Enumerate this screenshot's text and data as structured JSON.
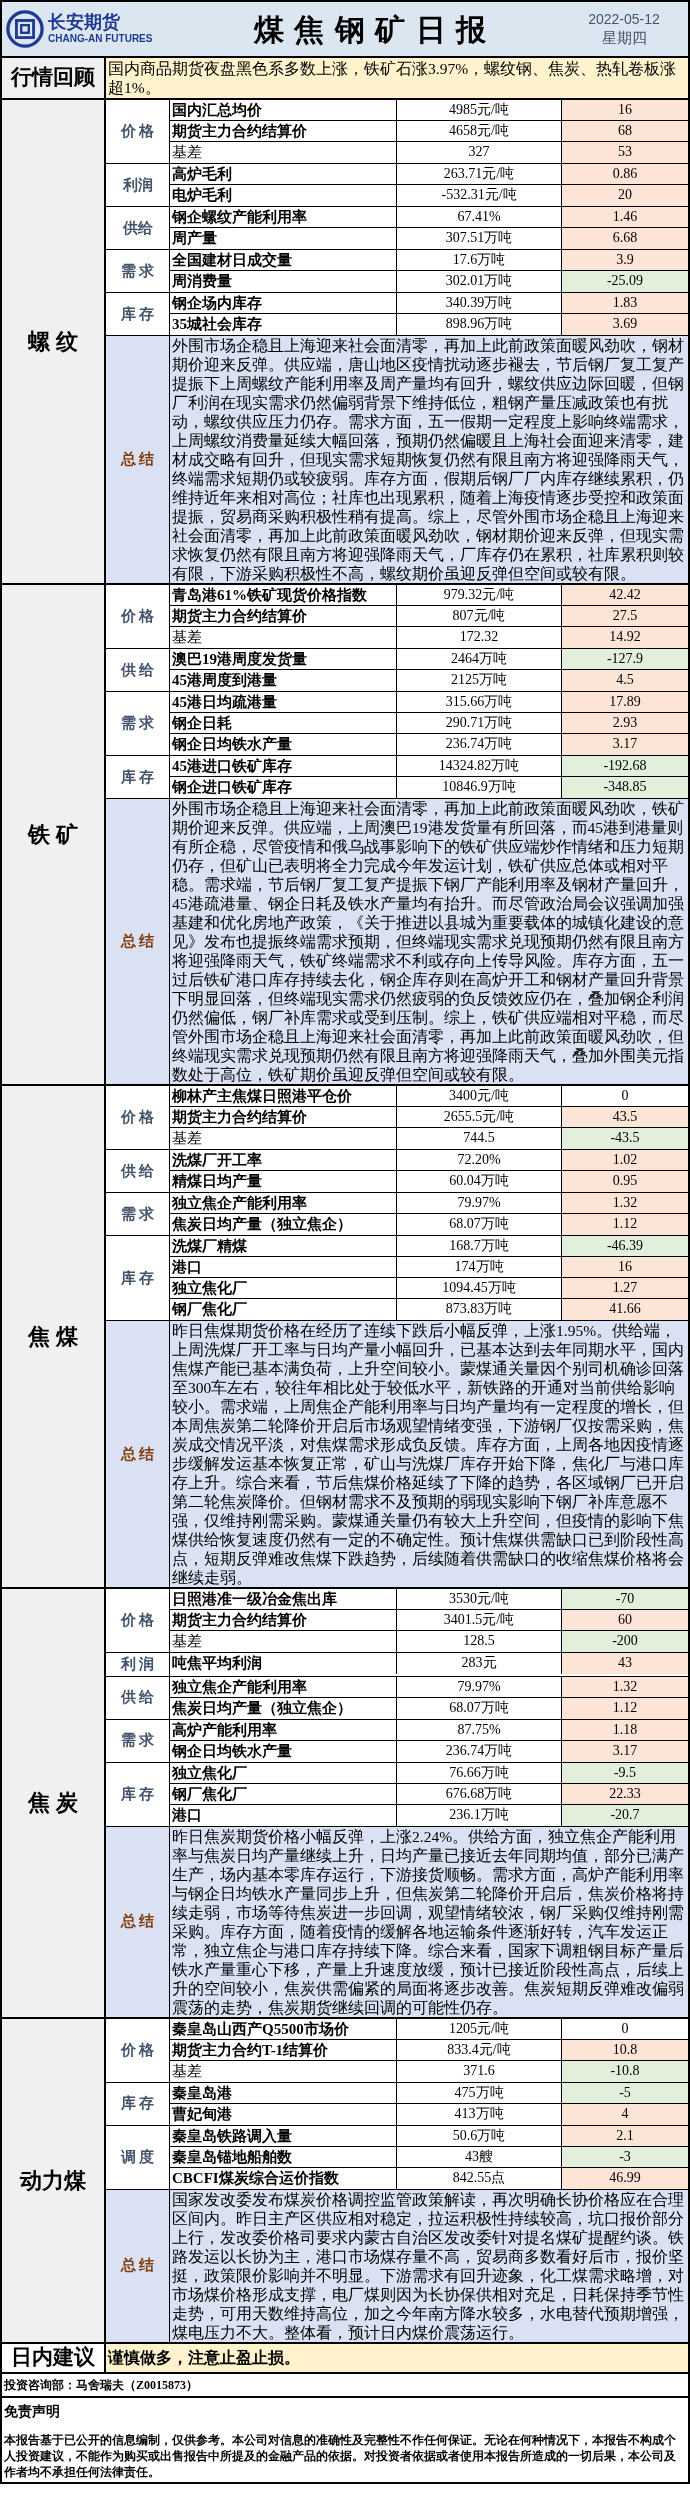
{
  "header": {
    "logo_cn": "长安期货",
    "logo_en": "CHANG-AN FUTURES",
    "title": "煤 焦 钢 矿 日 报",
    "date": "2022-05-12",
    "weekday": "星期四"
  },
  "review": {
    "label": "行情回顾",
    "text": "国内商品期货夜盘黑色系多数上涨，铁矿石涨3.97%，螺纹钢、焦炭、热轧卷板涨超1%。"
  },
  "sections": [
    {
      "name": "螺 纹",
      "groups": [
        {
          "category": "价 格",
          "rows": [
            {
              "name": "国内汇总均价",
              "bold": true,
              "value": "4985元/吨",
              "change": "16",
              "color": "#fce4d6"
            },
            {
              "name": "期货主力合约结算价",
              "bold": true,
              "value": "4658元/吨",
              "change": "68",
              "color": "#fce4d6"
            },
            {
              "name": "基差",
              "bold": false,
              "value": "327",
              "change": "53",
              "color": "#fce4d6"
            }
          ]
        },
        {
          "category": "利润",
          "rows": [
            {
              "name": "高炉毛利",
              "bold": true,
              "value": "263.71元/吨",
              "change": "0.86",
              "color": "#fce4d6"
            },
            {
              "name": "电炉毛利",
              "bold": true,
              "value": "-532.31元/吨",
              "change": "20",
              "color": "#fce4d6"
            }
          ]
        },
        {
          "category": "供给",
          "rows": [
            {
              "name": "钢企螺纹产能利用率",
              "bold": true,
              "value": "67.41%",
              "change": "1.46",
              "color": "#fce4d6"
            },
            {
              "name": "周产量",
              "bold": true,
              "value": "307.51万吨",
              "change": "6.68",
              "color": "#fce4d6"
            }
          ]
        },
        {
          "category": "需 求",
          "rows": [
            {
              "name": "全国建材日成交量",
              "bold": true,
              "value": "17.6万吨",
              "change": "3.9",
              "color": "#fce4d6"
            },
            {
              "name": "周消费量",
              "bold": true,
              "value": "302.01万吨",
              "change": "-25.09",
              "color": "#e2efda"
            }
          ]
        },
        {
          "category": "库 存",
          "rows": [
            {
              "name": "钢企场内库存",
              "bold": true,
              "value": "340.39万吨",
              "change": "1.83",
              "color": "#fce4d6"
            },
            {
              "name": "35城社会库存",
              "bold": true,
              "value": "898.96万吨",
              "change": "3.69",
              "color": "#fce4d6"
            }
          ]
        }
      ],
      "summary": {
        "label": "总 结",
        "text": "外围市场企稳且上海迎来社会面清零，再加上此前政策面暖风劲吹，钢材期价迎来反弹。供应端，唐山地区疫情扰动逐步褪去，节后钢厂复工复产提振下上周螺纹产能利用率及周产量均有回升，螺纹供应边际回暖，但钢厂利润在现实需求仍然偏弱背景下维持低位，粗钢产量压减政策也有扰动，螺纹供应压力仍存。需求方面，五一假期一定程度上影响终端需求，上周螺纹消费量延续大幅回落，预期仍然偏暖且上海社会面迎来清零，建材成交略有回升，但现实需求短期恢复仍然有限且南方将迎强降雨天气，终端需求短期仍或较疲弱。库存方面，假期后钢厂厂内库存继续累积，仍维持近年来相对高位；社库也出现累积，随着上海疫情逐步受控和政策面提振，贸易商采购积极性稍有提高。综上，尽管外围市场企稳且上海迎来社会面清零，再加上此前政策面暖风劲吹，钢材期价迎来反弹，但现实需求恢复仍然有限且南方将迎强降雨天气，厂库存仍在累积，社库累积则较有限，下游采购积极性不高，螺纹期价虽迎反弹但空间或较有限。"
      }
    },
    {
      "name": "铁 矿",
      "groups": [
        {
          "category": "价 格",
          "rows": [
            {
              "name": "青岛港61%铁矿现货价格指数",
              "bold": true,
              "value": "979.32元/吨",
              "change": "42.42",
              "color": "#fce4d6"
            },
            {
              "name": "期货主力合约结算价",
              "bold": true,
              "value": "807元/吨",
              "change": "27.5",
              "color": "#fce4d6"
            },
            {
              "name": "基差",
              "bold": false,
              "value": "172.32",
              "change": "14.92",
              "color": "#fce4d6"
            }
          ]
        },
        {
          "category": "供 给",
          "rows": [
            {
              "name": "澳巴19港周度发货量",
              "bold": true,
              "value": "2464万吨",
              "change": "-127.9",
              "color": "#e2efda"
            },
            {
              "name": "45港周度到港量",
              "bold": true,
              "value": "2125万吨",
              "change": "4.5",
              "color": "#fce4d6"
            }
          ]
        },
        {
          "category": "需 求",
          "rows": [
            {
              "name": "45港日均疏港量",
              "bold": true,
              "value": "315.66万吨",
              "change": "17.89",
              "color": "#fce4d6"
            },
            {
              "name": "钢企日耗",
              "bold": true,
              "value": "290.71万吨",
              "change": "2.93",
              "color": "#fce4d6"
            },
            {
              "name": "钢企日均铁水产量",
              "bold": true,
              "value": "236.74万吨",
              "change": "3.17",
              "color": "#fce4d6"
            }
          ]
        },
        {
          "category": "库 存",
          "rows": [
            {
              "name": "45港进口铁矿库存",
              "bold": true,
              "value": "14324.82万吨",
              "change": "-192.68",
              "color": "#e2efda"
            },
            {
              "name": "钢企进口铁矿库存",
              "bold": true,
              "value": "10846.9万吨",
              "change": "-348.85",
              "color": "#e2efda"
            }
          ]
        }
      ],
      "summary": {
        "label": "总 结",
        "text": "外围市场企稳且上海迎来社会面清零，再加上此前政策面暖风劲吹，铁矿期价迎来反弹。供应端，上周澳巴19港发货量有所回落，而45港到港量则有所企稳，尽管疫情和俄乌战事影响下的铁矿供应端炒作情绪和压力短期仍存，但矿山已表明将全力完成今年发运计划，铁矿供应总体或相对平稳。需求端，节后钢厂复工复产提振下钢厂产能利用率及钢材产量回升，45港疏港量、钢企日耗及铁水产量均有抬升。而尽管政治局会议强调加强基建和优化房地产政策，《关于推进以县城为重要载体的城镇化建设的意见》发布也提振终端需求预期，但终端现实需求兑现预期仍然有限且南方将迎强降雨天气，铁矿终端需求不利或存向上传导风险。库存方面，五一过后铁矿港口库存持续去化，钢企库存则在高炉开工和钢材产量回升背景下明显回落，但终端现实需求仍然疲弱的负反馈效应仍在，叠加钢企利润仍然偏低，钢厂补库需求或受到压制。综上，铁矿供应端相对平稳，而尽管外围市场企稳且上海迎来社会面清零，再加上此前政策面暖风劲吹，但终端现实需求兑现预期仍然有限且南方将迎强降雨天气，叠加外围美元指数处于高位，铁矿期价虽迎反弹但空间或较有限。"
      }
    },
    {
      "name": "焦 煤",
      "groups": [
        {
          "category": "价 格",
          "rows": [
            {
              "name": "柳林产主焦煤日照港平仓价",
              "bold": true,
              "value": "3400元/吨",
              "change": "0",
              "color": "#ffffff"
            },
            {
              "name": "期货主力合约结算价",
              "bold": true,
              "value": "2655.5元/吨",
              "change": "43.5",
              "color": "#fce4d6"
            },
            {
              "name": "基差",
              "bold": false,
              "value": "744.5",
              "change": "-43.5",
              "color": "#e2efda"
            }
          ]
        },
        {
          "category": "供 给",
          "rows": [
            {
              "name": "洗煤厂开工率",
              "bold": true,
              "value": "72.20%",
              "change": "1.02",
              "color": "#fce4d6"
            },
            {
              "name": "精煤日均产量",
              "bold": true,
              "value": "60.04万吨",
              "change": "0.95",
              "color": "#fce4d6"
            }
          ]
        },
        {
          "category": "需 求",
          "rows": [
            {
              "name": "独立焦企产能利用率",
              "bold": true,
              "value": "79.97%",
              "change": "1.32",
              "color": "#fce4d6"
            },
            {
              "name": "焦炭日均产量（独立焦企）",
              "bold": true,
              "value": "68.07万吨",
              "change": "1.12",
              "color": "#fce4d6"
            }
          ]
        },
        {
          "category": "库 存",
          "rows": [
            {
              "name": "洗煤厂精煤",
              "bold": true,
              "value": "168.7万吨",
              "change": "-46.39",
              "color": "#e2efda"
            },
            {
              "name": "港口",
              "bold": true,
              "value": "174万吨",
              "change": "16",
              "color": "#fce4d6"
            },
            {
              "name": "独立焦化厂",
              "bold": true,
              "value": "1094.45万吨",
              "change": "1.27",
              "color": "#fce4d6"
            },
            {
              "name": "钢厂焦化厂",
              "bold": true,
              "value": "873.83万吨",
              "change": "41.66",
              "color": "#fce4d6"
            }
          ]
        }
      ],
      "summary": {
        "label": "总 结",
        "text": "昨日焦煤期货价格在经历了连续下跌后小幅反弹，上涨1.95%。供给端，上周洗煤厂开工率与日均产量小幅回升，已基本达到去年同期水平，国内焦煤产能已基本满负荷，上升空间较小。蒙煤通关量因个别司机确诊回落至300车左右，较往年相比处于较低水平，新铁路的开通对当前供给影响较小。需求端，上周焦企产能利用率与日均产量均有一定程度的增长，但本周焦炭第二轮降价开启后市场观望情绪变强，下游钢厂仅按需采购，焦炭成交情况平淡，对焦煤需求形成负反馈。库存方面，上周各地因疫情逐步缓解发运基本恢复正常，矿山与洗煤厂库存开始下降，焦化厂与港口库存上升。综合来看，节后焦煤价格延续了下降的趋势，各区域钢厂已开启第二轮焦炭降价。但钢材需求不及预期的弱现实影响下钢厂补库意愿不强，仅维持刚需采购。蒙煤通关量仍有较大上升空间，但疫情的影响下焦煤供给恢复速度仍然有一定的不确定性。预计焦煤供需缺口已到阶段性高点，短期反弹难改焦煤下跌趋势，后续随着供需缺口的收缩焦煤价格将会继续走弱。"
      }
    },
    {
      "name": "焦 炭",
      "groups": [
        {
          "category": "价 格",
          "rows": [
            {
              "name": "日照港准一级冶金焦出库",
              "bold": true,
              "value": "3530元/吨",
              "change": "-70",
              "color": "#e2efda"
            },
            {
              "name": "期货主力合约结算价",
              "bold": true,
              "value": "3401.5元/吨",
              "change": "60",
              "color": "#fce4d6"
            },
            {
              "name": "基差",
              "bold": false,
              "value": "128.5",
              "change": "-200",
              "color": "#e2efda"
            }
          ]
        },
        {
          "category": "利 润",
          "rows": [
            {
              "name": "吨焦平均利润",
              "bold": true,
              "value": "283元",
              "change": "43",
              "color": "#fce4d6"
            }
          ]
        },
        {
          "category": "供 给",
          "rows": [
            {
              "name": "独立焦企产能利用率",
              "bold": true,
              "value": "79.97%",
              "change": "1.32",
              "color": "#fce4d6"
            },
            {
              "name": "焦炭日均产量（独立焦企）",
              "bold": true,
              "value": "68.07万吨",
              "change": "1.12",
              "color": "#fce4d6"
            }
          ]
        },
        {
          "category": "需 求",
          "rows": [
            {
              "name": "高炉产能利用率",
              "bold": true,
              "value": "87.75%",
              "change": "1.18",
              "color": "#fce4d6"
            },
            {
              "name": "钢企日均铁水产量",
              "bold": true,
              "value": "236.74万吨",
              "change": "3.17",
              "color": "#fce4d6"
            }
          ]
        },
        {
          "category": "库 存",
          "rows": [
            {
              "name": "独立焦化厂",
              "bold": true,
              "value": "76.66万吨",
              "change": "-9.5",
              "color": "#e2efda"
            },
            {
              "name": "钢厂焦化厂",
              "bold": true,
              "value": "676.68万吨",
              "change": "22.33",
              "color": "#fce4d6"
            },
            {
              "name": "港口",
              "bold": true,
              "value": "236.1万吨",
              "change": "-20.7",
              "color": "#e2efda"
            }
          ]
        }
      ],
      "summary": {
        "label": "总 结",
        "text": "昨日焦炭期货价格小幅反弹，上涨2.24%。供给方面，独立焦企产能利用率与焦炭日均产量继续上升，日均产量已接近去年同期均值，部分已满产生产，场内基本零库存运行，下游接货顺畅。需求方面，高炉产能利用率与钢企日均铁水产量同步上升，但焦炭第二轮降价开启后，焦炭价格将持续走弱，市场等待焦炭进一步回调，观望情绪较浓，钢厂采购仅维持刚需采购。库存方面，随着疫情的缓解各地运输条件逐渐好转，汽车发运正常，独立焦企与港口库存持续下降。综合来看，国家下调粗钢目标产量后铁水产量重心下移，产量上升速度放缓，预计已接近阶段性高点，后续上升的空间较小，焦炭供需偏紧的局面将逐步改善。焦炭短期反弹难改偏弱震荡的走势，焦炭期货继续回调的可能性仍存。"
      }
    },
    {
      "name": "动力煤",
      "groups": [
        {
          "category": "价 格",
          "rows": [
            {
              "name": "秦皇岛山西产Q5500市场价",
              "bold": true,
              "value": "1205元/吨",
              "change": "0",
              "color": "#ffffff"
            },
            {
              "name": "期货主力合约T-1结算价",
              "bold": true,
              "value": "833.4元/吨",
              "change": "10.8",
              "color": "#fce4d6"
            },
            {
              "name": "基差",
              "bold": false,
              "value": "371.6",
              "change": "-10.8",
              "color": "#e2efda"
            }
          ]
        },
        {
          "category": "库 存",
          "rows": [
            {
              "name": "秦皇岛港",
              "bold": true,
              "value": "475万吨",
              "change": "-5",
              "color": "#e2efda"
            },
            {
              "name": "曹妃甸港",
              "bold": true,
              "value": "413万吨",
              "change": "4",
              "color": "#fce4d6"
            }
          ]
        },
        {
          "category": "调 度",
          "rows": [
            {
              "name": "秦皇岛铁路调入量",
              "bold": true,
              "value": "50.6万吨",
              "change": "2.1",
              "color": "#fce4d6"
            },
            {
              "name": "秦皇岛锚地船舶数",
              "bold": true,
              "value": "43艘",
              "change": "-3",
              "color": "#e2efda"
            },
            {
              "name": "CBCFI煤炭综合运价指数",
              "bold": true,
              "value": "842.55点",
              "change": "46.99",
              "color": "#fce4d6"
            }
          ]
        }
      ],
      "summary": {
        "label": "总 结",
        "text": "国家发改委发布煤炭价格调控监管政策解读，再次明确长协价格应在合理区间内。昨日主产区供应相对稳定，拉运积极性持续较高，坑口报价部分上行，发改委价格司要求内蒙古自治区发改委针对提名煤矿提醒约谈。铁路发运以长协为主，港口市场煤存量不高，贸易商多数看好后市，报价坚挺，政策限价影响并不明显。下游需求有回升迹象，化工煤需求略增，对市场煤价格形成支撑，电厂煤则因为长协保供相对充足，日耗保持季节性走势，可用天数维持高位，加之今年南方降水较多，水电替代预期增强，煤电压力不大。整体看，预计日内煤价震荡运行。"
      }
    }
  ],
  "advice": {
    "label": "日内建议",
    "text": "谨慎做多，注意止盈止损。"
  },
  "contact": "投资咨询部：马舍瑞夫（Z0015873）",
  "disclaimer": {
    "title": "免责声明",
    "text": "本报告基于已公开的信息编制，仅供参考。本公司对信息的准确性及完整性不作任何保证。无论在何种情况下，本报告不构成个人投资建议，不能作为购买或出售报告中所提及的金融产品的依据。对投资者依据或者使用本报告所造成的一切后果，本公司及作者均不承担任何法律责任。"
  }
}
